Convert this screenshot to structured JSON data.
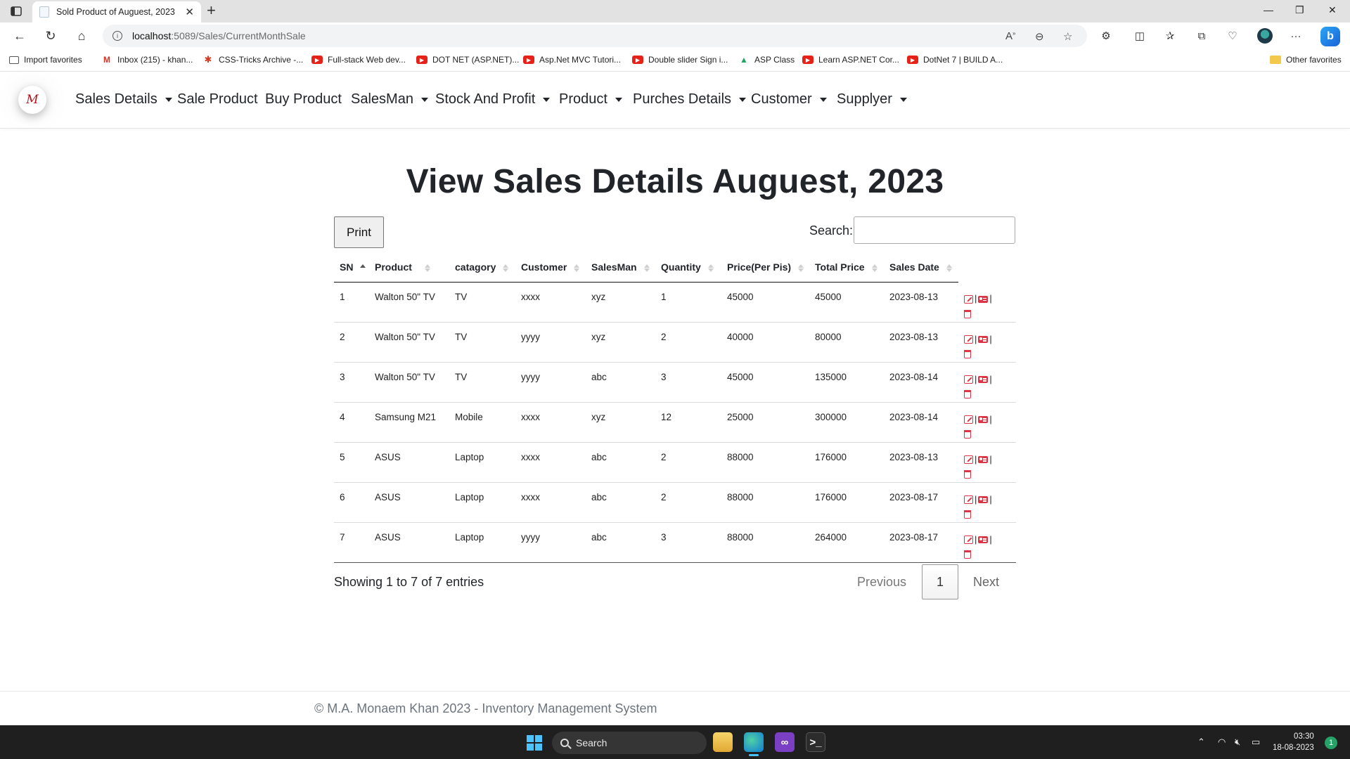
{
  "browser": {
    "tab_title": "Sold Product of Auguest, 2023",
    "url_host": "localhost",
    "url_path": ":5089/Sales/CurrentMonthSale",
    "favorites": [
      {
        "label": "Import favorites",
        "icon": "import-icon"
      },
      {
        "label": "Inbox (215) - khan...",
        "icon": "gmail-icon"
      },
      {
        "label": "CSS-Tricks Archive -...",
        "icon": "css-tricks-icon"
      },
      {
        "label": "Full-stack Web dev...",
        "icon": "youtube-icon"
      },
      {
        "label": "DOT NET (ASP.NET)...",
        "icon": "youtube-icon"
      },
      {
        "label": "Asp.Net MVC Tutori...",
        "icon": "youtube-icon"
      },
      {
        "label": "Double slider Sign i...",
        "icon": "youtube-icon"
      },
      {
        "label": "ASP Class",
        "icon": "google-drive-icon"
      },
      {
        "label": "Learn ASP.NET Cor...",
        "icon": "youtube-icon"
      },
      {
        "label": "DotNet 7 | BUILD A...",
        "icon": "youtube-icon"
      }
    ],
    "other_favorites": "Other favorites"
  },
  "nav": {
    "brand": "M",
    "items": [
      {
        "label": "Sales Details",
        "dropdown": true
      },
      {
        "label": "Sale Product",
        "dropdown": false
      },
      {
        "label": "Buy Product",
        "dropdown": false
      },
      {
        "label": "SalesMan",
        "dropdown": true
      },
      {
        "label": "Stock And Profit",
        "dropdown": true
      },
      {
        "label": "Product",
        "dropdown": true
      },
      {
        "label": "Purches Details",
        "dropdown": true
      },
      {
        "label": "Customer",
        "dropdown": true
      },
      {
        "label": "Supplyer",
        "dropdown": true
      }
    ]
  },
  "main": {
    "heading": "View Sales Details Auguest, 2023",
    "print_label": "Print",
    "search_label": "Search:",
    "search_value": "",
    "columns": [
      "SN",
      "Product",
      "catagory",
      "Customer",
      "SalesMan",
      "Quantity",
      "Price(Per Pis)",
      "Total Price",
      "Sales Date"
    ],
    "rows": [
      [
        "1",
        "Walton 50\" TV",
        "TV",
        "xxxx",
        "xyz",
        "1",
        "45000",
        "45000",
        "2023-08-13"
      ],
      [
        "2",
        "Walton 50\" TV",
        "TV",
        "yyyy",
        "xyz",
        "2",
        "40000",
        "80000",
        "2023-08-13"
      ],
      [
        "3",
        "Walton 50\" TV",
        "TV",
        "yyyy",
        "abc",
        "3",
        "45000",
        "135000",
        "2023-08-14"
      ],
      [
        "4",
        "Samsung M21",
        "Mobile",
        "xxxx",
        "xyz",
        "12",
        "25000",
        "300000",
        "2023-08-14"
      ],
      [
        "5",
        "ASUS",
        "Laptop",
        "xxxx",
        "abc",
        "2",
        "88000",
        "176000",
        "2023-08-13"
      ],
      [
        "6",
        "ASUS",
        "Laptop",
        "xxxx",
        "abc",
        "2",
        "88000",
        "176000",
        "2023-08-17"
      ],
      [
        "7",
        "ASUS",
        "Laptop",
        "yyyy",
        "abc",
        "3",
        "88000",
        "264000",
        "2023-08-17"
      ]
    ],
    "action_separator": "|",
    "info": "Showing 1 to 7 of 7 entries",
    "pagination": {
      "previous": "Previous",
      "current": "1",
      "next": "Next"
    }
  },
  "footer": {
    "text": "© M.A. Monaem Khan 2023 - Inventory Management System"
  },
  "taskbar": {
    "search_label": "Search",
    "time": "03:30",
    "date": "18-08-2023",
    "notification_count": "1"
  },
  "colors": {
    "brand_red": "#b4121b",
    "action_red": "#dc3545",
    "taskbar_bg": "#1f1f1f",
    "windows_blue": "#4cc2ff"
  }
}
